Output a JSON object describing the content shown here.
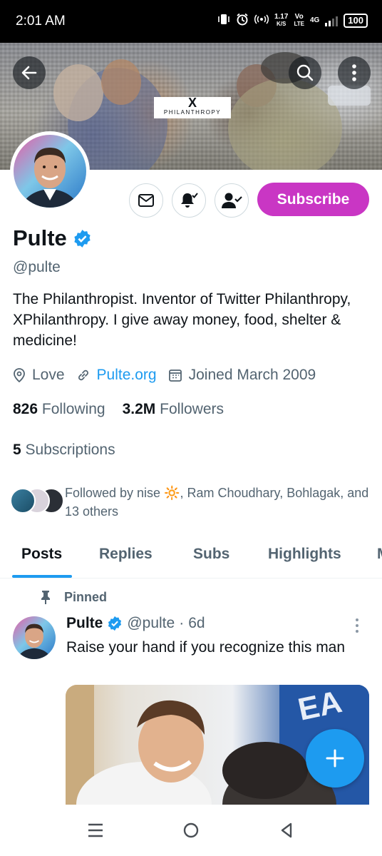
{
  "status_bar": {
    "time": "2:01 AM",
    "speed_value": "1.17",
    "speed_unit": "K/S",
    "volte": "Vo",
    "volte_sub": "LTE",
    "network": "4G",
    "battery": "100"
  },
  "banner": {
    "logo_x": "X",
    "logo_text": "PHILANTHROPY"
  },
  "profile": {
    "name": "Pulte",
    "handle": "@pulte",
    "bio": "The Philanthropist. Inventor of Twitter Philanthropy, XPhilanthropy. I give away money, food, shelter & medicine!",
    "location": "Love",
    "website": "Pulte.org",
    "joined": "Joined March 2009",
    "following_count": "826",
    "following_label": "Following",
    "followers_count": "3.2M",
    "followers_label": "Followers",
    "subscriptions_count": "5",
    "subscriptions_label": "Subscriptions",
    "followed_by": "Followed by nise 🔆, Ram Choudhary, Bohlagak, and 13 others"
  },
  "actions": {
    "subscribe_label": "Subscribe"
  },
  "tabs": [
    {
      "label": "Posts"
    },
    {
      "label": "Replies"
    },
    {
      "label": "Subs"
    },
    {
      "label": "Highlights"
    },
    {
      "label": "M"
    }
  ],
  "pinned_tweet": {
    "pinned_label": "Pinned",
    "author_name": "Pulte",
    "author_handle": "@pulte",
    "separator": "·",
    "time": "6d",
    "text": "Raise your hand if you recognize this man"
  },
  "colors": {
    "accent": "#1d9bf0",
    "subscribe": "#c936c4",
    "muted_text": "#536471"
  }
}
